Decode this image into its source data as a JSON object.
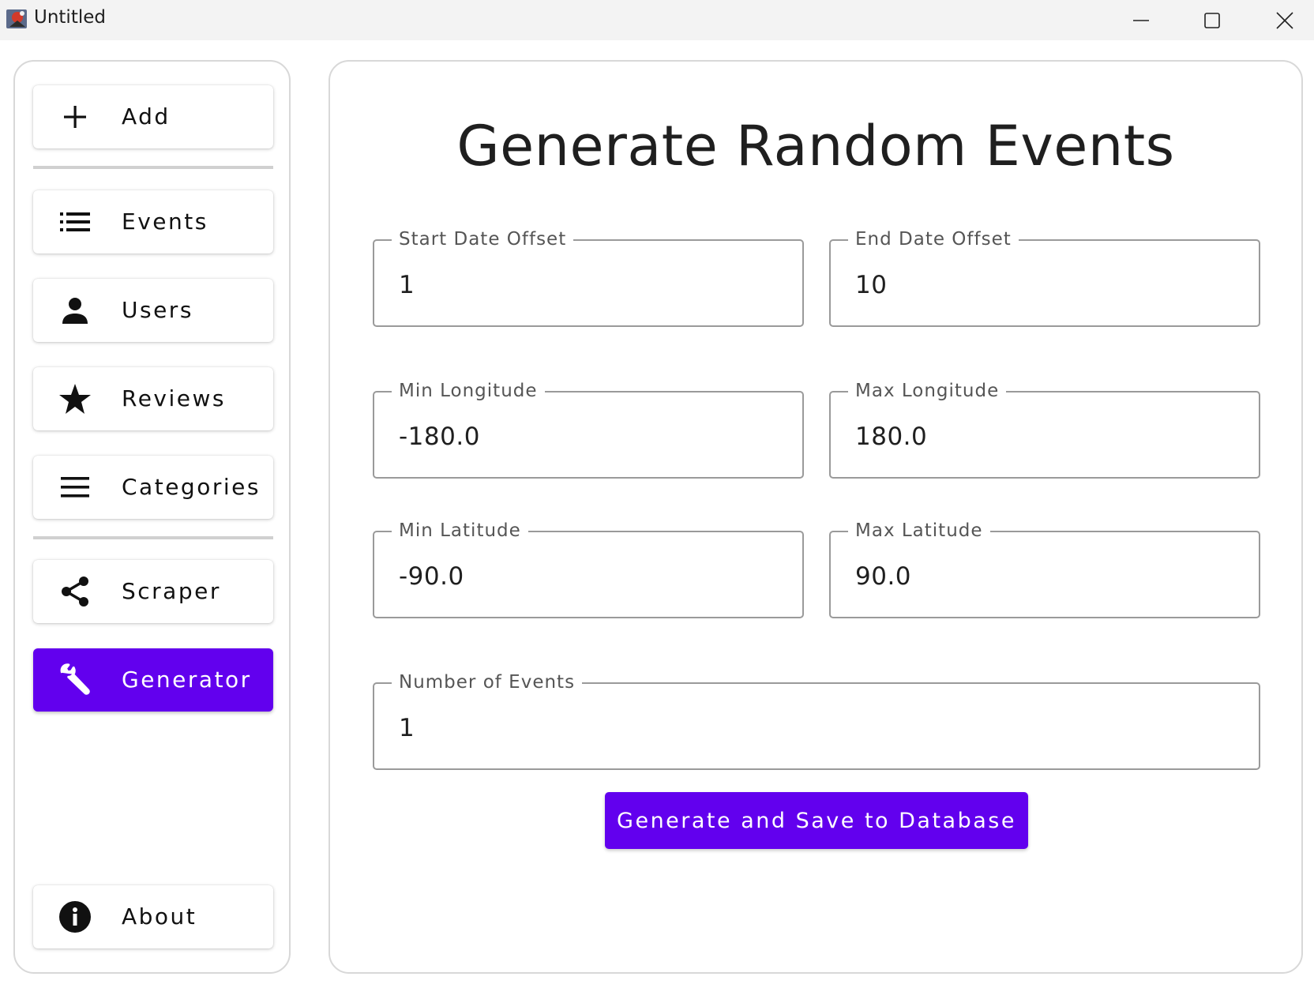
{
  "window": {
    "title": "Untitled",
    "controls": [
      "minimize-icon",
      "maximize-icon",
      "close-icon"
    ]
  },
  "sidebar": {
    "items": [
      {
        "label": "Add",
        "icon": "plus-icon"
      },
      {
        "label": "Events",
        "icon": "list-icon"
      },
      {
        "label": "Users",
        "icon": "person-icon"
      },
      {
        "label": "Reviews",
        "icon": "star-icon"
      },
      {
        "label": "Categories",
        "icon": "menu-icon"
      },
      {
        "label": "Scraper",
        "icon": "share-icon"
      },
      {
        "label": "Generator",
        "icon": "wrench-icon",
        "active": true
      },
      {
        "label": "About",
        "icon": "info-icon"
      }
    ]
  },
  "main": {
    "title": "Generate Random Events",
    "fields": {
      "start_date_offset": {
        "label": "Start Date Offset",
        "value": "1"
      },
      "end_date_offset": {
        "label": "End Date Offset",
        "value": "10"
      },
      "min_longitude": {
        "label": "Min Longitude",
        "value": "-180.0"
      },
      "max_longitude": {
        "label": "Max Longitude",
        "value": "180.0"
      },
      "min_latitude": {
        "label": "Min Latitude",
        "value": "-90.0"
      },
      "max_latitude": {
        "label": "Max Latitude",
        "value": "90.0"
      },
      "number_of_events": {
        "label": "Number of Events",
        "value": "1"
      }
    },
    "submit_label": "Generate and Save to Database"
  },
  "colors": {
    "accent": "#6200ee",
    "titlebar": "#f3f3f3",
    "border": "#d8d8d8"
  }
}
